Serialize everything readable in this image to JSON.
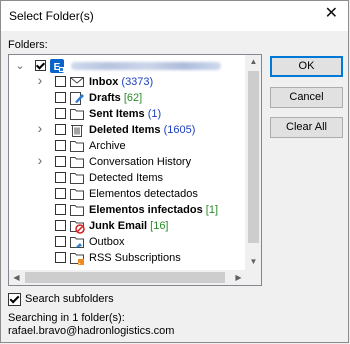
{
  "window": {
    "title": "Select Folder(s)",
    "close_glyph": "✕"
  },
  "folders_label": "Folders:",
  "tree": {
    "account_redacted": true,
    "items": [
      {
        "label": "Inbox",
        "count": "(3373)",
        "count_color": "blue",
        "bold": true,
        "expandable": true,
        "icon": "inbox-icon"
      },
      {
        "label": "Drafts",
        "count": "[62]",
        "count_color": "green",
        "bold": true,
        "expandable": false,
        "icon": "drafts-icon"
      },
      {
        "label": "Sent Items",
        "count": "(1)",
        "count_color": "blue",
        "bold": true,
        "expandable": false,
        "icon": "folder-icon"
      },
      {
        "label": "Deleted Items",
        "count": "(1605)",
        "count_color": "blue",
        "bold": true,
        "expandable": true,
        "icon": "trash-icon"
      },
      {
        "label": "Archive",
        "count": "",
        "bold": false,
        "expandable": false,
        "icon": "folder-icon"
      },
      {
        "label": "Conversation History",
        "count": "",
        "bold": false,
        "expandable": true,
        "icon": "folder-icon"
      },
      {
        "label": "Detected Items",
        "count": "",
        "bold": false,
        "expandable": false,
        "icon": "folder-icon"
      },
      {
        "label": "Elementos detectados",
        "count": "",
        "bold": false,
        "expandable": false,
        "icon": "folder-icon"
      },
      {
        "label": "Elementos infectados",
        "count": "[1]",
        "count_color": "green",
        "bold": true,
        "expandable": false,
        "icon": "folder-icon"
      },
      {
        "label": "Junk Email",
        "count": "[16]",
        "count_color": "green",
        "bold": true,
        "expandable": false,
        "icon": "junk-icon"
      },
      {
        "label": "Outbox",
        "count": "",
        "bold": false,
        "expandable": false,
        "icon": "outbox-icon"
      },
      {
        "label": "RSS Subscriptions",
        "count": "",
        "bold": false,
        "expandable": false,
        "icon": "rss-icon"
      }
    ]
  },
  "buttons": {
    "ok": "OK",
    "cancel": "Cancel",
    "clear_all": "Clear All"
  },
  "search_subfolders": {
    "label": "Search subfolders",
    "checked": true
  },
  "status": {
    "searching": "Searching in 1 folder(s):",
    "email": "rafael.bravo@hadronlogistics.com"
  },
  "colors": {
    "accent": "#0078d7",
    "count_blue": "#1b3fbf",
    "count_green": "#2a8a2a"
  }
}
